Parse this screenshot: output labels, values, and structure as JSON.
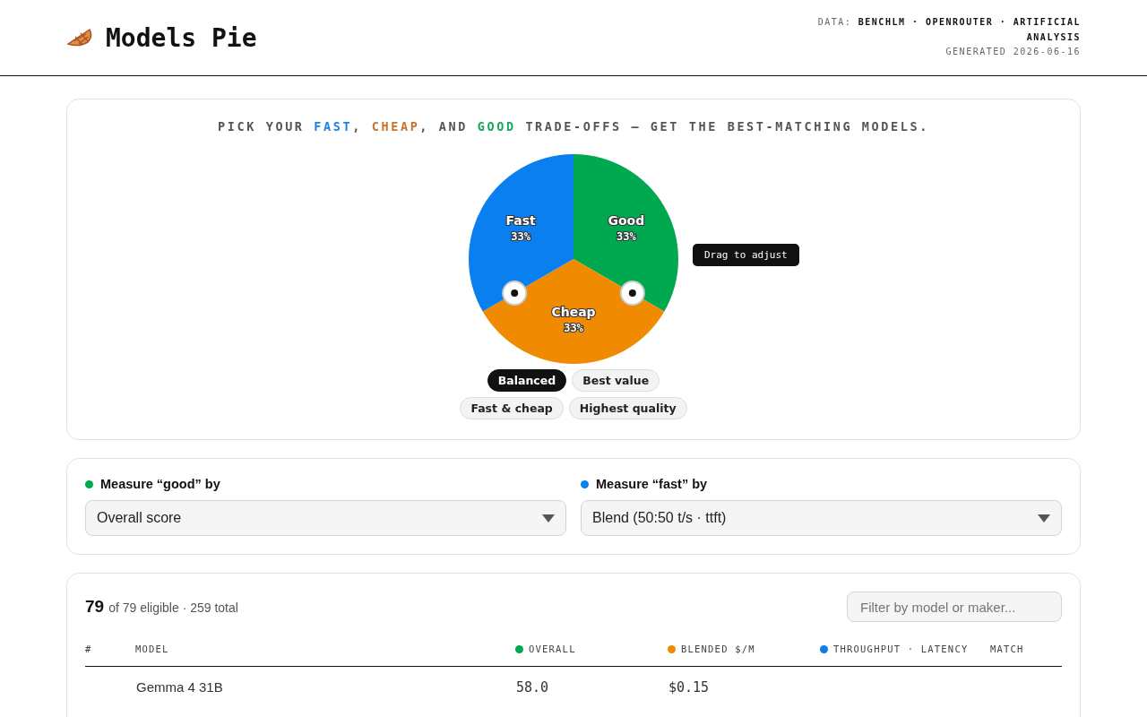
{
  "header": {
    "title": "Models Pie",
    "sources_label": "DATA:",
    "sources": "BENCHLM · OPENROUTER · ARTIFICIAL ANALYSIS",
    "generated": "GENERATED 2026-06-16"
  },
  "tagline": [
    {
      "text": "PICK YOUR ",
      "color": "#555555"
    },
    {
      "text": "FAST",
      "color": "#1a82e2"
    },
    {
      "text": ", ",
      "color": "#555555"
    },
    {
      "text": "CHEAP",
      "color": "#c8732a"
    },
    {
      "text": ", AND ",
      "color": "#555555"
    },
    {
      "text": "GOOD",
      "color": "#19a55a"
    },
    {
      "text": " TRADE-OFFS — GET THE BEST-MATCHING MODELS.",
      "color": "#555555"
    }
  ],
  "pie": {
    "chart_data": {
      "type": "pie",
      "categories": [
        "Good",
        "Cheap",
        "Fast"
      ],
      "values": [
        33.33,
        33.33,
        33.34
      ],
      "value_labels": [
        "33%",
        "33%",
        "33%"
      ]
    },
    "slices": [
      {
        "color": "#00a84f"
      },
      {
        "color": "#f08a00"
      },
      {
        "color": "#0a7ff0"
      }
    ],
    "tooltip": "Drag to adjust"
  },
  "presets": [
    {
      "label": "Balanced",
      "selected": true
    },
    {
      "label": "Best value",
      "selected": false
    },
    {
      "label": "Fast & cheap",
      "selected": false
    },
    {
      "label": "Highest quality",
      "selected": false
    }
  ],
  "measures": [
    {
      "label": "Measure “good” by",
      "color": "#00a84f",
      "value": "Overall score"
    },
    {
      "label": "Measure “fast” by",
      "color": "#0a7ff0",
      "value": "Blend (50:50 t/s · ttft)"
    }
  ],
  "results": {
    "count": "79",
    "summary": "of 79 eligible · 259 total",
    "filter_placeholder": "Filter by model or maker...",
    "columns": [
      {
        "label": "#"
      },
      {
        "label": "MODEL"
      },
      {
        "label": "OVERALL",
        "color": "#00a84f"
      },
      {
        "label": "BLENDED $/M",
        "color": "#f08a00"
      },
      {
        "label": "THROUGHPUT · LATENCY",
        "color": "#0a7ff0"
      },
      {
        "label": "MATCH"
      }
    ],
    "rows": [
      {
        "model": "Gemma 4 31B",
        "overall": "58.0",
        "price": "$0.15"
      }
    ]
  }
}
